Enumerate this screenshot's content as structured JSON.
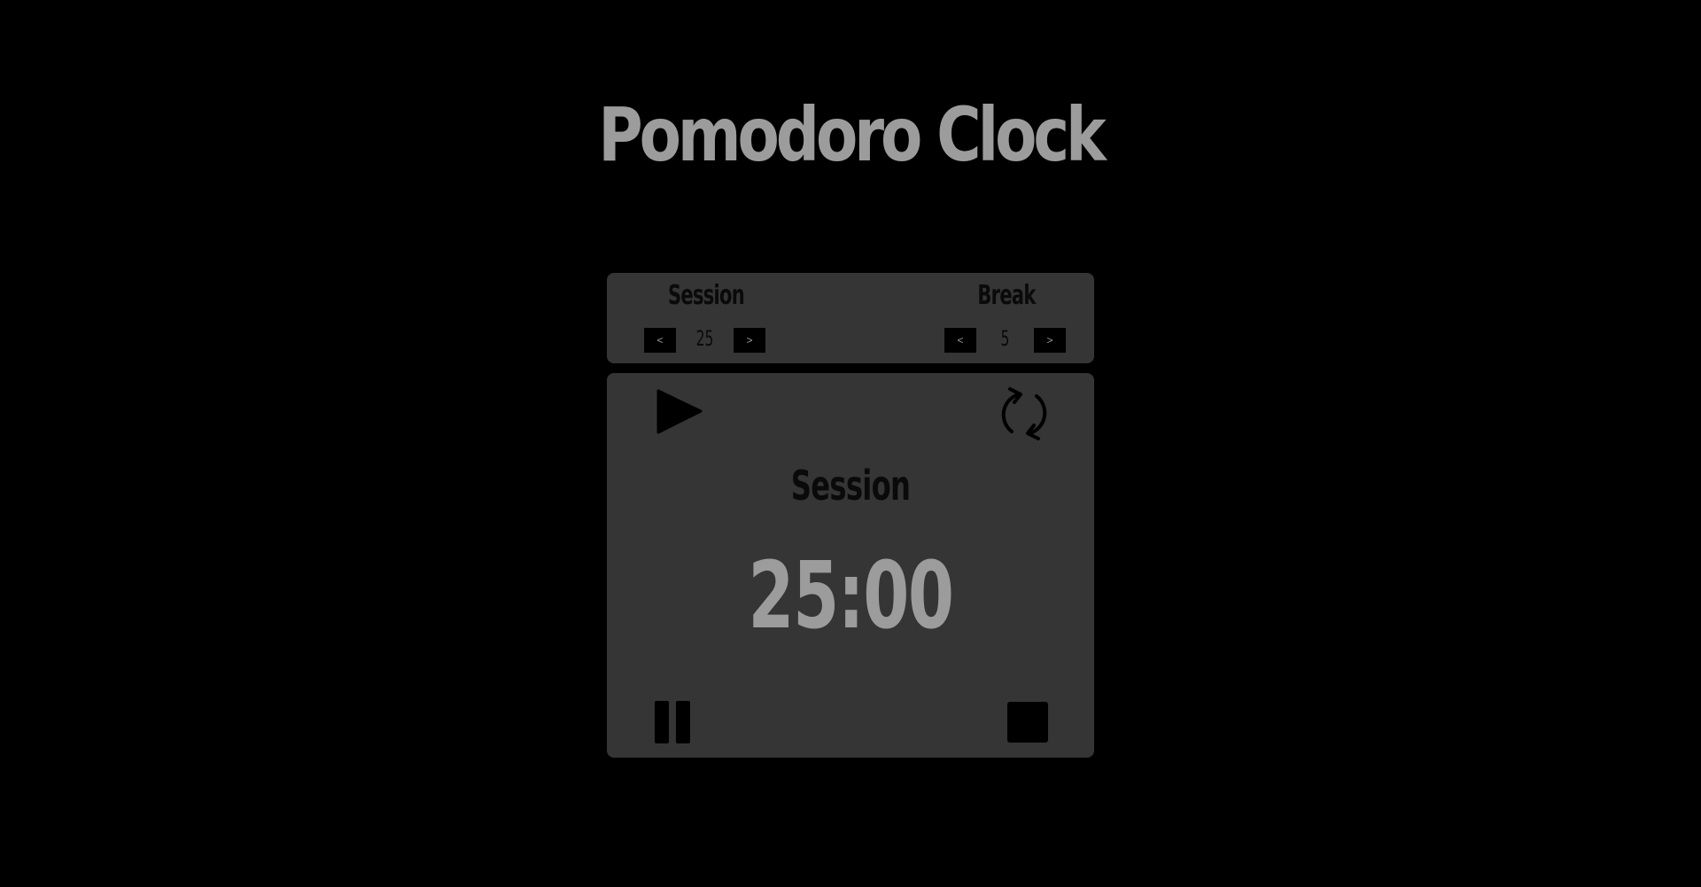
{
  "header": {
    "title": "Pomodoro Clock"
  },
  "settings": {
    "session": {
      "label": "Session",
      "value": "25",
      "dec_label": "<",
      "inc_label": ">"
    },
    "break": {
      "label": "Break",
      "value": "5",
      "dec_label": "<",
      "inc_label": ">"
    }
  },
  "timer": {
    "mode": "Session",
    "time": "25:00",
    "controls": {
      "play": "play-icon",
      "refresh": "refresh-icon",
      "pause": "pause-icon",
      "stop": "stop-icon"
    }
  },
  "colors": {
    "background": "#000000",
    "panel": "#353535",
    "title": "#9c9c9c",
    "dark_text": "#0a0a0a",
    "time": "#9c9c9c"
  }
}
